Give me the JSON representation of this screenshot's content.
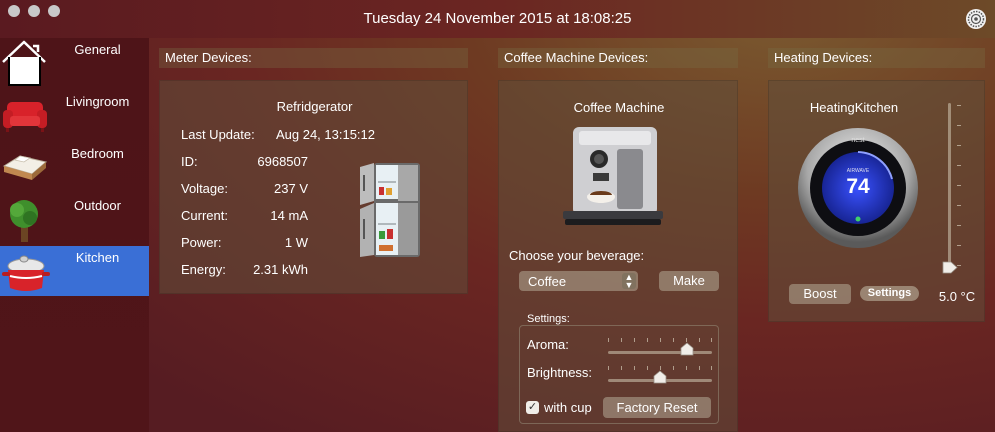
{
  "window": {
    "title": "Tuesday 24 November 2015 at 18:08:25"
  },
  "sidebar": {
    "items": [
      {
        "label": "General",
        "icon": "house-icon"
      },
      {
        "label": "Livingroom",
        "icon": "sofa-icon"
      },
      {
        "label": "Bedroom",
        "icon": "bed-icon"
      },
      {
        "label": "Outdoor",
        "icon": "tree-icon"
      },
      {
        "label": "Kitchen",
        "icon": "cooking-pot-icon",
        "selected": true
      }
    ]
  },
  "meter": {
    "header": "Meter Devices:",
    "device_name": "Refridgerator",
    "rows": [
      {
        "label": "Last Update:",
        "value": "Aug 24, 13:15:12"
      },
      {
        "label": "ID:",
        "value": "6968507"
      },
      {
        "label": "Voltage:",
        "value": "237 V"
      },
      {
        "label": "Current:",
        "value": "14 mA"
      },
      {
        "label": "Power:",
        "value": "1 W"
      },
      {
        "label": "Energy:",
        "value": "2.31 kWh"
      }
    ]
  },
  "coffee": {
    "header": "Coffee Machine Devices:",
    "device_name": "Coffee Machine",
    "choose_label": "Choose your beverage:",
    "beverage_selected": "Coffee",
    "make_label": "Make",
    "settings_label": "Settings:",
    "aroma_label": "Aroma:",
    "aroma_level": 0.8,
    "brightness_label": "Brightness:",
    "brightness_level": 0.5,
    "with_cup_label": "with cup",
    "with_cup_checked": true,
    "factory_reset_label": "Factory Reset"
  },
  "heating": {
    "header": "Heating Devices:",
    "device_name": "HeatingKitchen",
    "thermostat_brand": "nest",
    "thermostat_mode": "AIRWAVE",
    "thermostat_temp": "74",
    "boost_label": "Boost",
    "settings_label": "Settings",
    "temp_readout": "5.0 °C",
    "temp_slider_level": 0.0
  },
  "colors": {
    "selection_blue": "#3a6fd6",
    "thermostat_blue": "#2b3fd0"
  }
}
